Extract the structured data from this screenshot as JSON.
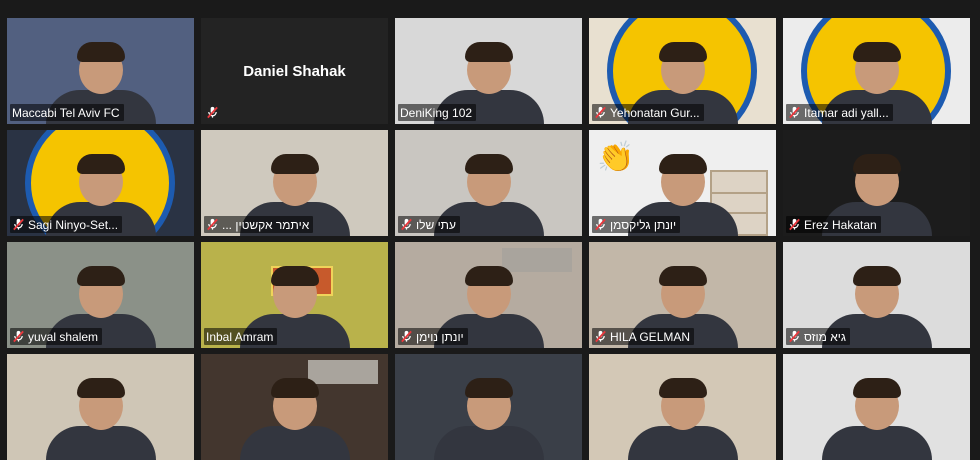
{
  "participants": [
    {
      "name": "Maccabi Tel Aviv FC",
      "muted": false,
      "bg": "#526080"
    },
    {
      "name": "Daniel Shahak",
      "muted": true,
      "bg": "#232323",
      "no_video": true
    },
    {
      "name": "DeniKing 102",
      "muted": false,
      "bg": "#d8d8d8"
    },
    {
      "name": "Yehonatan Gur...",
      "muted": true,
      "bg": "#e8e0d0",
      "logo": true
    },
    {
      "name": "Itamar adi yall...",
      "muted": true,
      "bg": "#ececec",
      "logo": true
    },
    {
      "name": "Sagi Ninyo-Set...",
      "muted": true,
      "bg": "#2a3344",
      "logo": true
    },
    {
      "name": "... איתמר אקשטין",
      "muted": true,
      "bg": "#cfc9be"
    },
    {
      "name": "עתי שלו",
      "muted": true,
      "bg": "#c9c6c1"
    },
    {
      "name": "יונתן גליקסמן",
      "muted": true,
      "bg": "#efefef",
      "clap": true
    },
    {
      "name": "Erez Hakatan",
      "muted": true,
      "bg": "#1c1c1c"
    },
    {
      "name": "yuval shalem",
      "muted": true,
      "bg": "#8b9188"
    },
    {
      "name": "Inbal Amram",
      "muted": false,
      "bg": "#b9b24b",
      "active": true
    },
    {
      "name": "יונתן נוימן",
      "muted": true,
      "bg": "#b5aba0"
    },
    {
      "name": "HILA GELMAN",
      "muted": true,
      "bg": "#c2b7a8"
    },
    {
      "name": "גיא מוזס",
      "muted": true,
      "bg": "#dcdcdc"
    },
    {
      "name": "",
      "muted": false,
      "bg": "#cfc6b6"
    },
    {
      "name": "",
      "muted": false,
      "bg": "#43362e"
    },
    {
      "name": "",
      "muted": false,
      "bg": "#3a3f48"
    },
    {
      "name": "",
      "muted": false,
      "bg": "#d3c8b6"
    },
    {
      "name": "",
      "muted": false,
      "bg": "#e1e1e1"
    }
  ],
  "colors": {
    "active_speaker": "#e6f23a",
    "mute_icon": "#e8383d",
    "club_yellow": "#f5c400",
    "club_blue": "#1d5bb0"
  }
}
